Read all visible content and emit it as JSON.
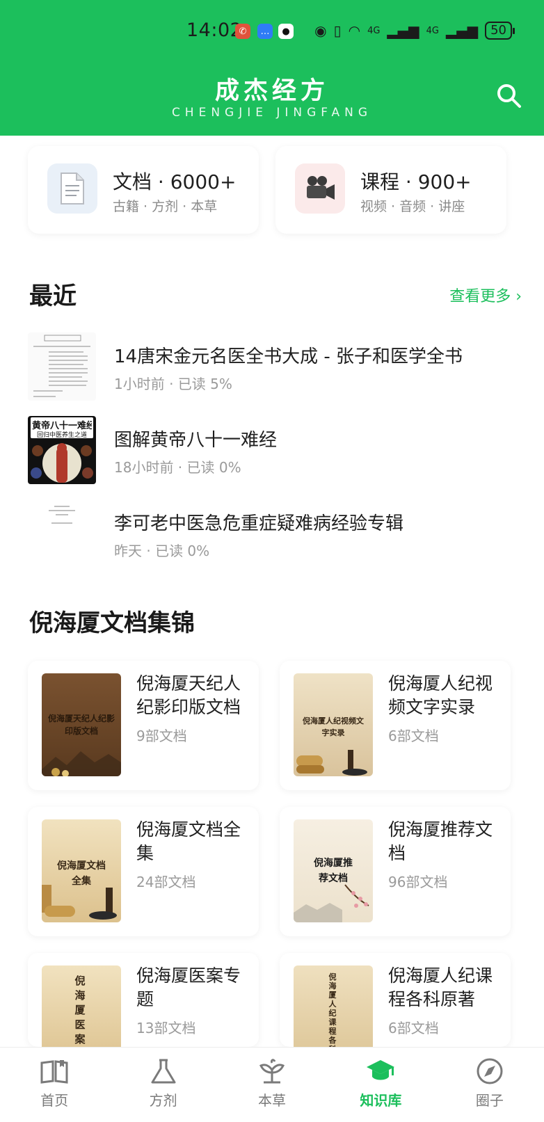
{
  "status_bar": {
    "time": "14:02",
    "battery": "50",
    "network_1": "4G",
    "network_2": "4G"
  },
  "header": {
    "title": "成杰经方",
    "subtitle": "CHENGJIE JINGFANG",
    "search_icon": "search-icon"
  },
  "stats": [
    {
      "title": "文档 · 6000+",
      "subtitle": "古籍 · 方剂 · 本草",
      "icon": "document-icon"
    },
    {
      "title": "课程 · 900+",
      "subtitle": "视频 · 音频 · 讲座",
      "icon": "video-camera-icon"
    }
  ],
  "recent": {
    "title": "最近",
    "see_more": "查看更多 ›",
    "items": [
      {
        "title": "14唐宋金元名医全书大成 - 张子和医学全书",
        "meta": "1小时前 · 已读 5%"
      },
      {
        "title": "图解黄帝八十一难经",
        "meta": "18小时前 · 已读 0%",
        "cover_text_1": "黄帝八十一难经",
        "cover_text_2": "回归中医养生之道"
      },
      {
        "title": "李可老中医急危重症疑难病经验专辑",
        "meta": "昨天 · 已读 0%"
      }
    ]
  },
  "collection": {
    "title": "倪海厦文档集锦",
    "items": [
      {
        "title": "倪海厦天纪人纪影印版文档",
        "count": "9部文档",
        "cover_text": "倪海厦天纪人纪影印版文档"
      },
      {
        "title": "倪海厦人纪视频文字实录",
        "count": "6部文档",
        "cover_text": "倪海厦人纪视频文字实录"
      },
      {
        "title": "倪海厦文档全集",
        "count": "24部文档",
        "cover_text": "倪海厦文档全集"
      },
      {
        "title": "倪海厦推荐文档",
        "count": "96部文档",
        "cover_text": "倪海厦推荐文档"
      },
      {
        "title": "倪海厦医案专题",
        "count": "13部文档",
        "cover_text": "倪海厦医案专"
      },
      {
        "title": "倪海厦人纪课程各科原著",
        "count": "6部文档",
        "cover_text": "倪海厦人纪课程各科"
      }
    ]
  },
  "bottom_nav": [
    {
      "label": "首页",
      "icon": "book-open-icon",
      "active": false
    },
    {
      "label": "方剂",
      "icon": "flask-icon",
      "active": false
    },
    {
      "label": "本草",
      "icon": "herb-icon",
      "active": false
    },
    {
      "label": "知识库",
      "icon": "graduation-cap-icon",
      "active": true
    },
    {
      "label": "圈子",
      "icon": "compass-icon",
      "active": false
    }
  ],
  "colors": {
    "brand": "#1cbf5c",
    "text": "#1f1f1f",
    "muted": "#9a9a9a"
  }
}
